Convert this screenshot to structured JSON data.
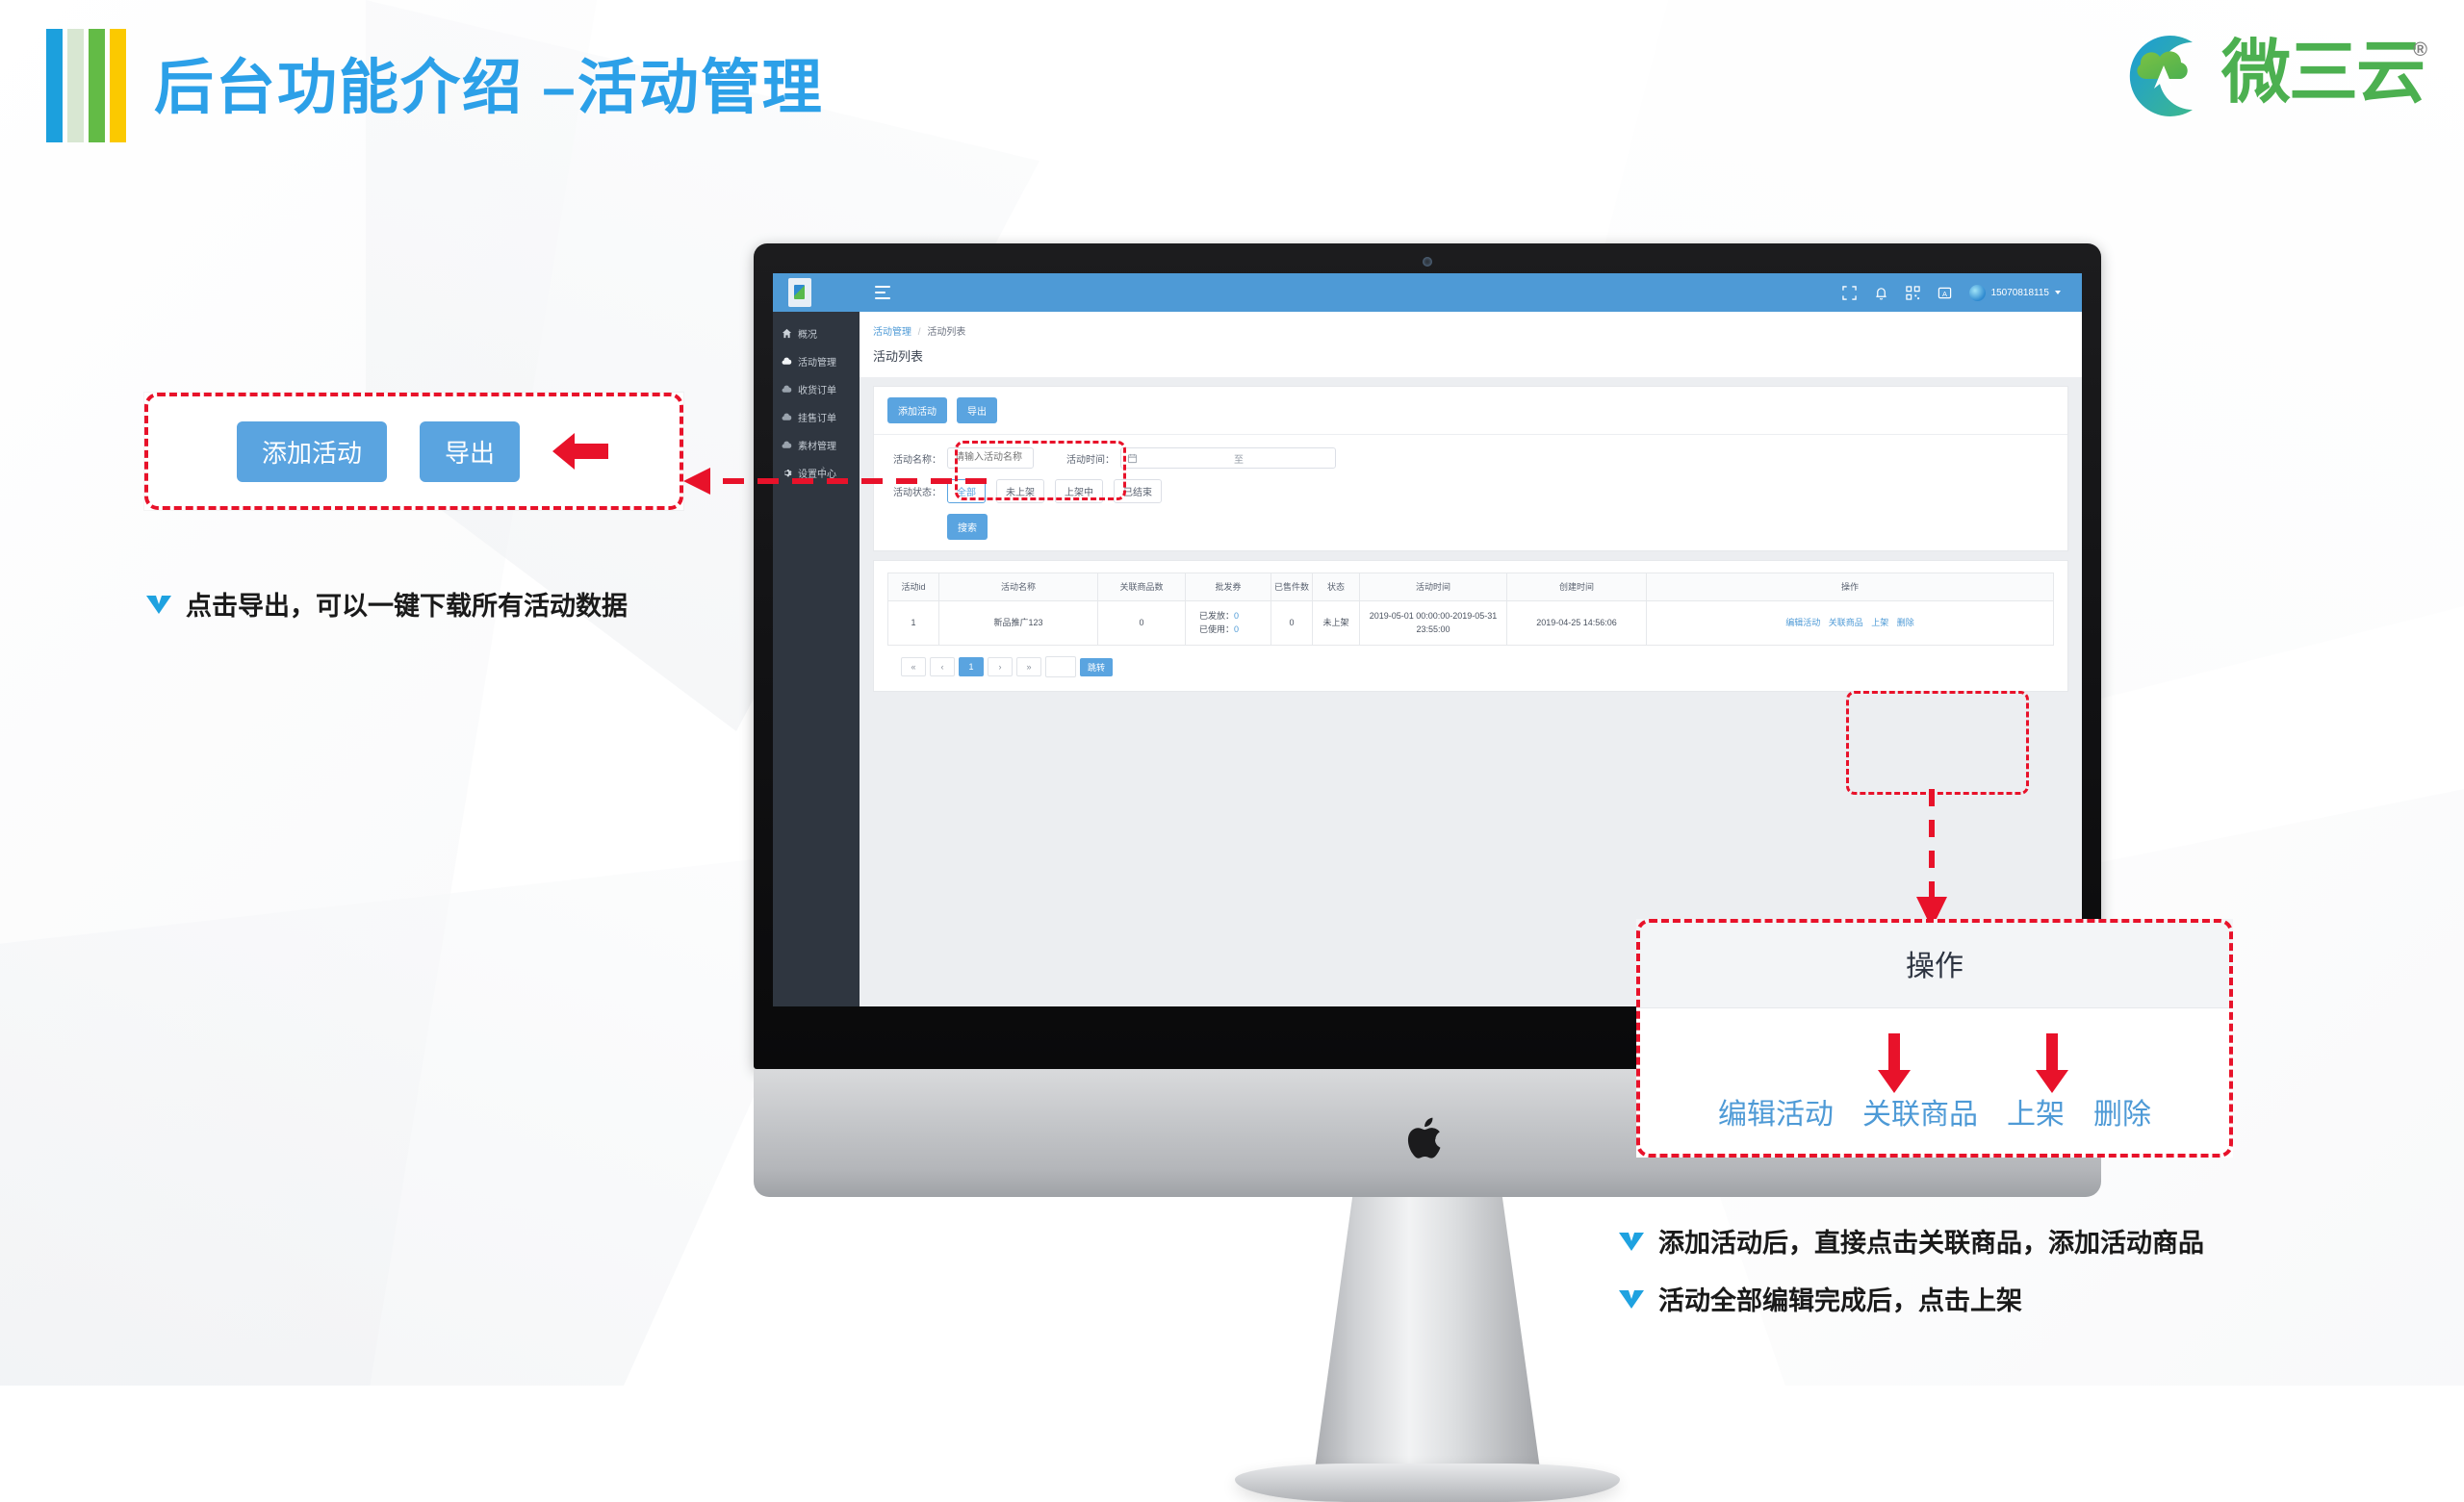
{
  "header": {
    "title": "后台功能介绍 –活动管理",
    "brand_name": "微三云",
    "brand_mark": "cloud-crescent-logo",
    "registered_mark": "®",
    "accent_blue": "#2ca0e8",
    "bars": [
      "#1ca0dd",
      "#d8e7d2",
      "#63bb46",
      "#fbc900"
    ]
  },
  "callout_left": {
    "add_button": "添加活动",
    "export_button": "导出",
    "arrow": "left-arrow-icon",
    "note": "点击导出，可以一键下载所有活动数据"
  },
  "callout_right": {
    "header": "操作",
    "actions": [
      "编辑活动",
      "关联商品",
      "上架",
      "删除"
    ],
    "arrow_targets": [
      "关联商品",
      "上架"
    ],
    "notes": [
      "添加活动后，直接点击关联商品，添加活动商品",
      "活动全部编辑完成后，点击上架"
    ]
  },
  "app": {
    "topbar": {
      "menu_icon": "hamburger-icon",
      "icons": [
        "fullscreen-icon",
        "bell-icon",
        "qrcode-icon",
        "letter-a-icon"
      ],
      "user_name": "15070818115",
      "bar_color": "#4e9ad6"
    },
    "sidebar": {
      "items": [
        {
          "label": "概况",
          "icon": "home-icon"
        },
        {
          "label": "活动管理",
          "icon": "cloud-icon"
        },
        {
          "label": "收货订单",
          "icon": "cloud-icon"
        },
        {
          "label": "挂售订单",
          "icon": "cloud-icon"
        },
        {
          "label": "素材管理",
          "icon": "cloud-icon"
        },
        {
          "label": "设置中心",
          "icon": "gear-icon",
          "chevron": "›"
        }
      ]
    },
    "breadcrumb": {
      "parent": "活动管理",
      "sep": "/",
      "current": "活动列表"
    },
    "page_title": "活动列表",
    "toolbar": {
      "add": "添加活动",
      "export": "导出"
    },
    "filters": {
      "name_label": "活动名称：",
      "name_placeholder": "请输入活动名称",
      "time_label": "活动时间：",
      "calendar_icon": "calendar-icon",
      "time_start": "",
      "time_sep": "至",
      "time_end": "",
      "status_label": "活动状态：",
      "status_options": [
        "全部",
        "未上架",
        "上架中",
        "已结束"
      ],
      "status_selected": "全部",
      "search": "搜索"
    },
    "table": {
      "columns": [
        "活动id",
        "活动名称",
        "关联商品数",
        "批发券",
        "已售件数",
        "状态",
        "活动时间",
        "创建时间",
        "操作"
      ],
      "rows": [
        {
          "id": "1",
          "name": "新品推广123",
          "goods_count": "0",
          "coupon_issued_label": "已发放：",
          "coupon_issued": "0",
          "coupon_used_label": "已使用：",
          "coupon_used": "0",
          "sold": "0",
          "status": "未上架",
          "activity_time": "2019-05-01 00:00:00-2019-05-31 23:55:00",
          "create_time": "2019-04-25 14:56:06",
          "actions": [
            "编辑活动",
            "关联商品",
            "上架",
            "删除"
          ]
        }
      ]
    },
    "pagination": {
      "first": "«",
      "prev": "‹",
      "pages": [
        "1"
      ],
      "current": "1",
      "next": "›",
      "last": "»",
      "jump_value": "",
      "jump_button": "跳转"
    }
  },
  "device": {
    "brand_logo": "apple-logo"
  }
}
